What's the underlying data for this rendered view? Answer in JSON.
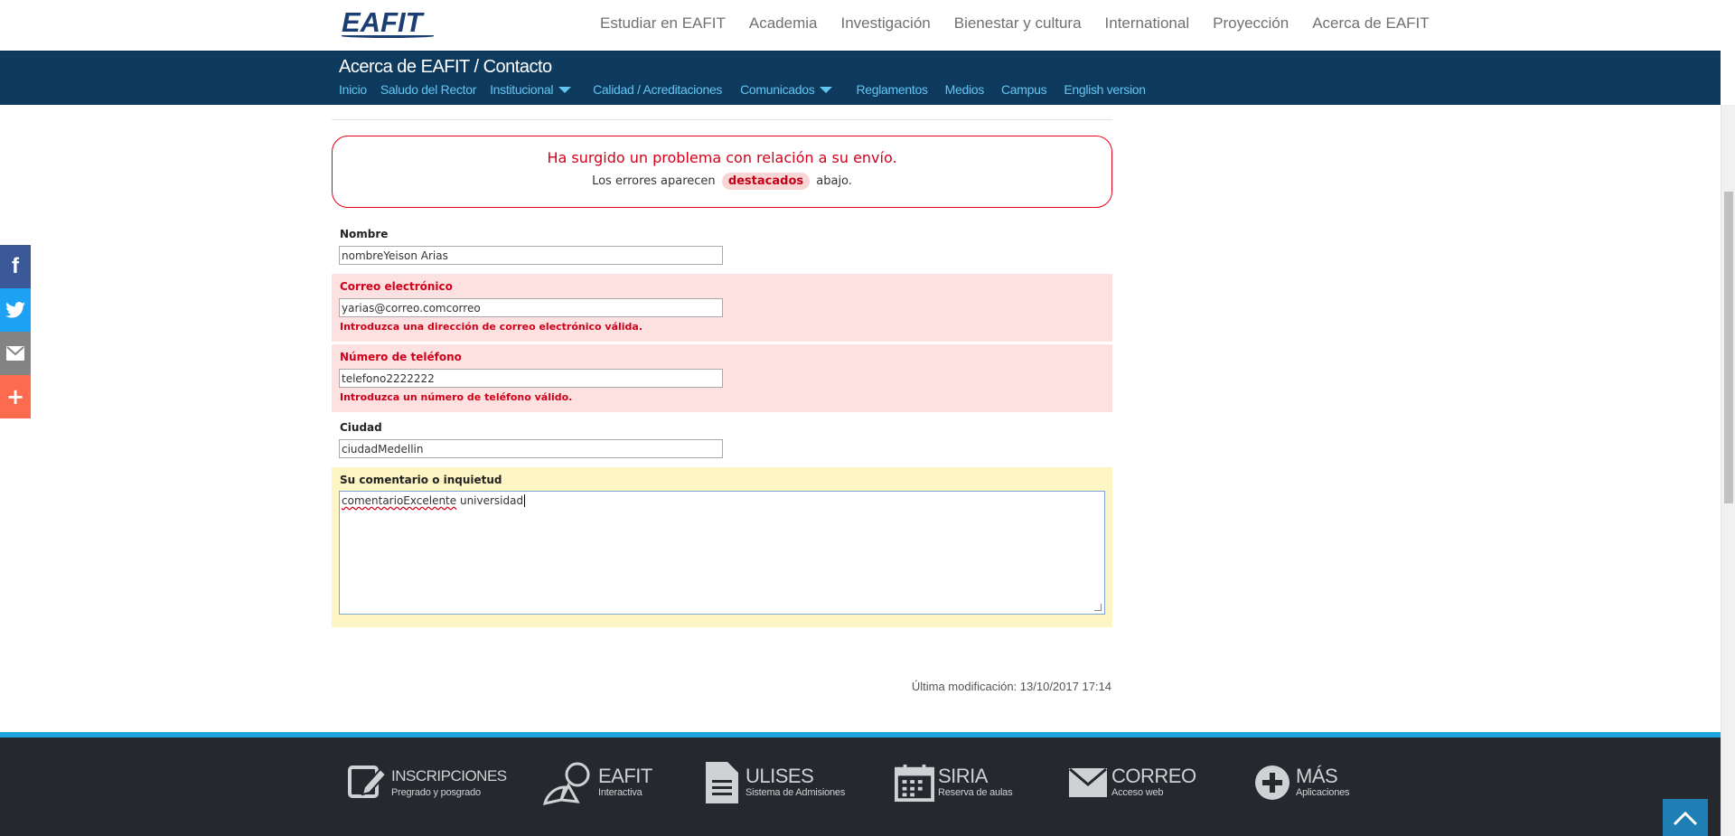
{
  "header": {
    "logo_text": "EAFIT",
    "menu": [
      "Estudiar en EAFIT",
      "Academia",
      "Investigación",
      "Bienestar y cultura",
      "International",
      "Proyección",
      "Acerca de EAFIT"
    ]
  },
  "section": {
    "title": "Acerca de EAFIT / Contacto",
    "menu": [
      "Inicio",
      "Saludo del Rector",
      "Institucional",
      "Calidad / Acreditaciones",
      "Comunicados",
      "Reglamentos",
      "Medios",
      "Campus",
      "English version"
    ]
  },
  "social": {
    "facebook_label": "f",
    "twitter_label": "t",
    "email_label": "✉",
    "more_label": "+",
    "colors": {
      "facebook": "#3b5998",
      "twitter": "#1da1f2",
      "email": "#848484",
      "more": "#fd6b4e"
    }
  },
  "alert": {
    "title": "Ha surgido un problema con relación a su envío.",
    "sub_before": "Los errores aparecen",
    "sub_highlight": "destacados",
    "sub_after": "abajo."
  },
  "form": {
    "nombre": {
      "label": "Nombre",
      "value": "nombreYeison Arias"
    },
    "correo": {
      "label": "Correo electrónico",
      "value": "yarias@correo.comcorreo",
      "error": "Introduzca una dirección de correo electrónico válida."
    },
    "telefono": {
      "label": "Número de teléfono",
      "value": "telefono2222222",
      "error": "Introduzca un número de teléfono válido."
    },
    "ciudad": {
      "label": "Ciudad",
      "value": "ciudadMedellin"
    },
    "comentario": {
      "label": "Su comentario o inquietud",
      "value_misspelled": "comentarioExcelente",
      "value_rest": " universidad"
    }
  },
  "last_modified": "Última modificación: 13/10/2017 17:14",
  "footer": {
    "items": [
      {
        "title": "INSCRIPCIONES",
        "sub": "Pregrado y posgrado",
        "icon": "edit-icon"
      },
      {
        "title": "EAFIT",
        "sub": "Interactiva",
        "icon": "cursor-icon"
      },
      {
        "title": "ULISES",
        "sub": "Sistema de Admisiones",
        "icon": "document-icon"
      },
      {
        "title": "SIRIA",
        "sub": "Reserva de aulas",
        "icon": "calendar-icon"
      },
      {
        "title": "CORREO",
        "sub": "Acceso web",
        "icon": "mail-icon"
      },
      {
        "title": "MÁS",
        "sub": "Aplicaciones",
        "icon": "plus-circle-icon"
      }
    ]
  },
  "colors": {
    "brand_blue": "#0e3a5e",
    "link_blue": "#63c5f2",
    "error_red": "#d0021b",
    "footer_bg": "#25282d"
  }
}
